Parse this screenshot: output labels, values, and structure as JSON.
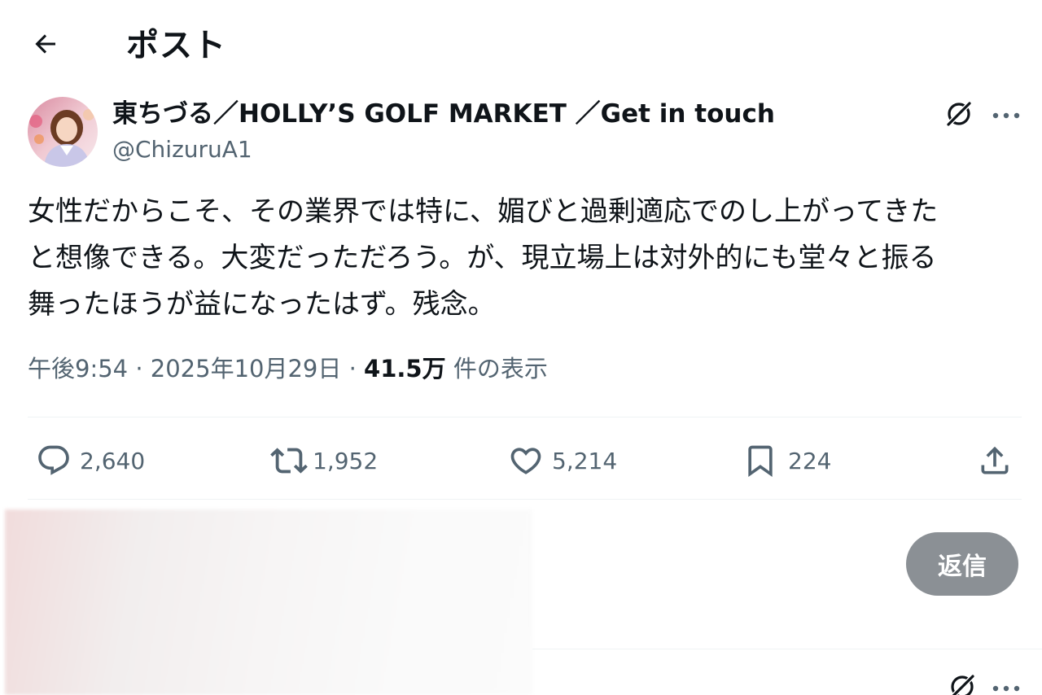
{
  "header": {
    "title": "ポスト"
  },
  "author": {
    "display_name": "東ちづる／HOLLY’S GOLF MARKET ／Get in touch",
    "handle": "@ChizuruA1"
  },
  "tweet": {
    "text": "女性だからこそ、その業界では特に、媚びと過剰適応でのし上がってきた\nと想像できる。大変だっただろう。が、現立場上は対外的にも堂々と振る\n舞ったほうが益になったはず。残念。",
    "time": "午後9:54",
    "separator": "·",
    "date": "2025年10月29日",
    "views_count": "41.5万",
    "views_label": "件の表示"
  },
  "actions": {
    "replies": "2,640",
    "reposts": "1,952",
    "likes": "5,214",
    "bookmarks": "224"
  },
  "composer": {
    "reply_label": "返信"
  },
  "icons": {
    "back": "back-arrow-icon",
    "grok": "grok-icon",
    "more": "more-dots-icon",
    "reply": "reply-bubble-icon",
    "repost": "repost-icon",
    "like": "heart-icon",
    "bookmark": "bookmark-icon",
    "share": "share-icon"
  },
  "colors": {
    "text": "#0f1419",
    "secondary": "#536471",
    "divider": "#eff3f4",
    "reply_button": "#8b9095"
  }
}
